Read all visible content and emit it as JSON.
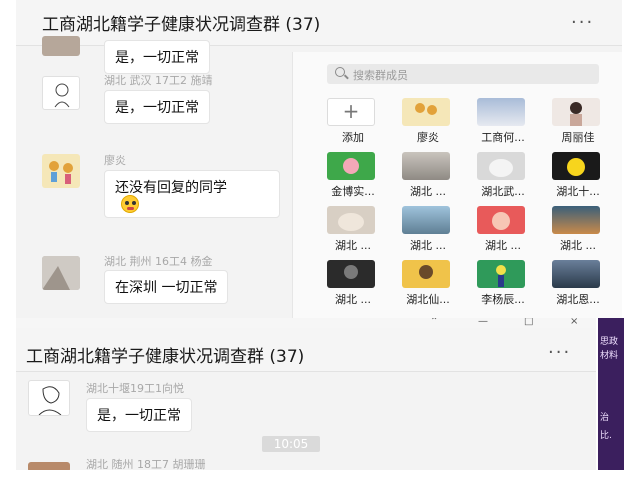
{
  "top": {
    "title": "工商湖北籍学子健康状况调查群 (37)",
    "more": "···",
    "messages": [
      {
        "name": "",
        "text": "是，一切正常"
      },
      {
        "name": "湖北 武汉 17工2 施靖",
        "text": "是，一切正常"
      },
      {
        "name": "廖炎",
        "text": "还没有回复的同学"
      },
      {
        "name": "湖北 荆州 16工4 杨金",
        "text": "在深圳 一切正常"
      }
    ],
    "members": {
      "search_placeholder": "搜索群成员",
      "add_label": "添加",
      "add_icon": "+",
      "list": [
        "廖炎",
        "工商何...",
        "周丽佳",
        "金博实...",
        "湖北 ...",
        "湖北武...",
        "湖北十...",
        "湖北 ...",
        "湖北 ...",
        "湖北 ...",
        "湖北 ...",
        "湖北 ...",
        "湖北仙...",
        "李杨辰...",
        "湖北恩..."
      ]
    }
  },
  "bottom": {
    "window_controls": [
      "⌃",
      "—",
      "□",
      "×"
    ],
    "title": "工商湖北籍学子健康状况调查群 (37)",
    "more": "···",
    "messages": [
      {
        "name": "湖北十堰19工1向悦",
        "text": "是，一切正常"
      },
      {
        "name": "湖北 随州 18工7 胡珊珊",
        "text": ""
      }
    ],
    "timestamp": "10:05"
  },
  "side_strip": [
    "思政",
    "材料",
    "治",
    "比."
  ],
  "colors": {
    "chat_bg": "#f3f3f3",
    "bubble_bg": "#ffffff",
    "name_gray": "#a8a8a8",
    "strip": "#3b1f5e"
  }
}
